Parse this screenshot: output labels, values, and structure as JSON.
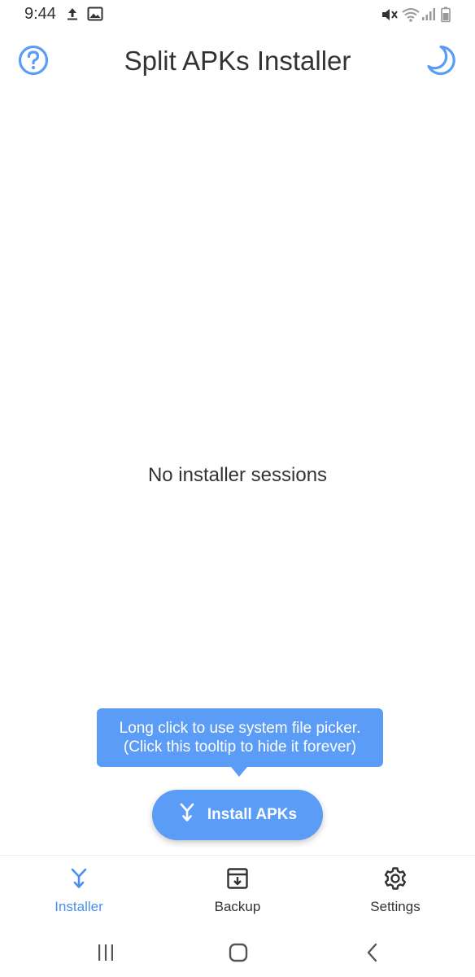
{
  "status_bar": {
    "time": "9:44",
    "icons": [
      "upload-icon",
      "image-icon",
      "mute-icon",
      "wifi-icon",
      "signal-icon",
      "battery-icon"
    ]
  },
  "header": {
    "title": "Split APKs Installer",
    "left_icon": "help-icon",
    "right_icon": "moon-icon"
  },
  "main": {
    "empty_text": "No installer sessions"
  },
  "tooltip": {
    "line1": "Long click to use system file picker.",
    "line2": "(Click this tooltip to hide it forever)"
  },
  "fab": {
    "label": "Install APKs",
    "icon": "merge-arrow-icon"
  },
  "bottom_nav": {
    "items": [
      {
        "label": "Installer",
        "icon": "merge-arrow-icon",
        "active": true
      },
      {
        "label": "Backup",
        "icon": "archive-icon",
        "active": false
      },
      {
        "label": "Settings",
        "icon": "gear-icon",
        "active": false
      }
    ]
  },
  "colors": {
    "accent": "#5b9cf6",
    "active_nav": "#4a8ff0",
    "text": "#333333"
  }
}
